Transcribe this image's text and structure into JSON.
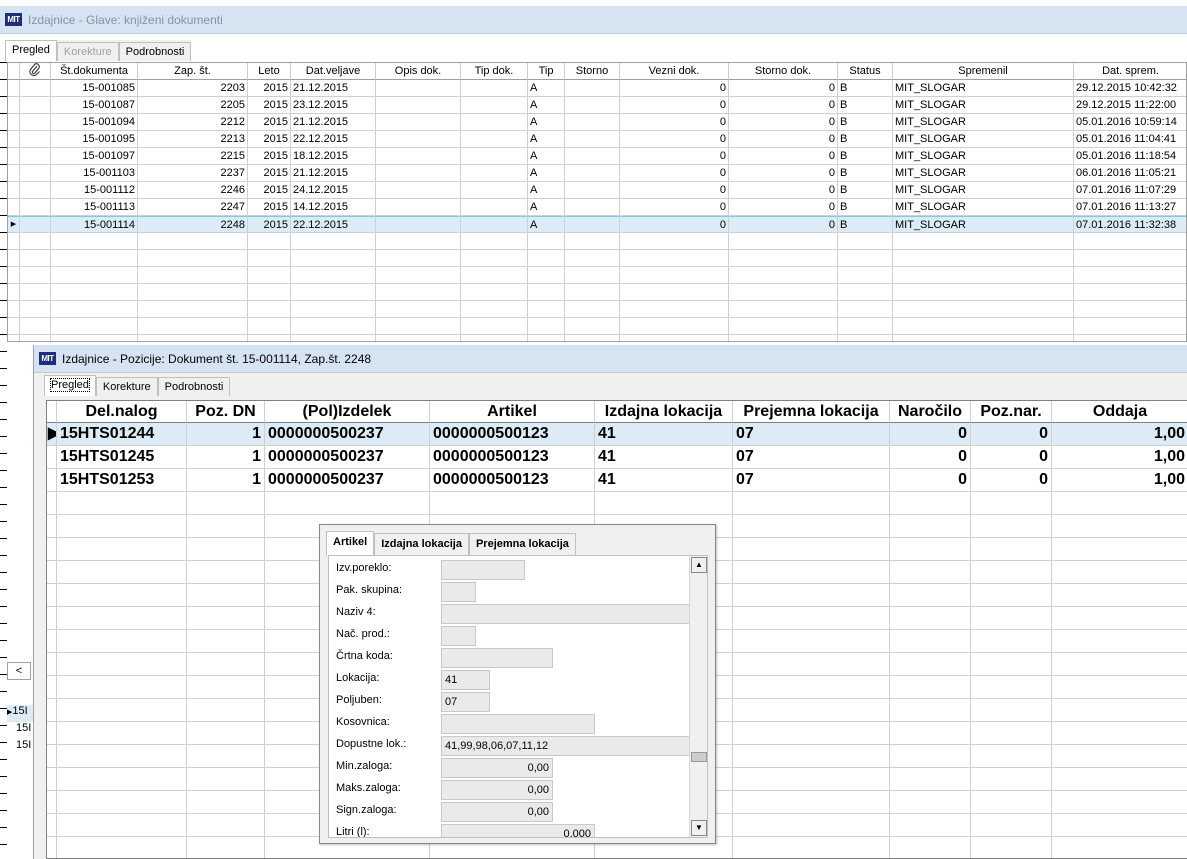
{
  "window1": {
    "title": "Izdajnice - Glave: knjiženi dokumenti",
    "tabs": [
      {
        "label": "Pregled",
        "state": "active"
      },
      {
        "label": "Korekture",
        "state": "disabled"
      },
      {
        "label": "Podrobnosti",
        "state": "normal"
      }
    ],
    "columns": [
      "Št.dokumenta",
      "Zap. št.",
      "Leto",
      "Dat.veljave",
      "Opis dok.",
      "Tip dok.",
      "Tip",
      "Storno",
      "Vezni dok.",
      "Storno dok.",
      "Status",
      "Spremenil",
      "Dat. sprem."
    ],
    "rows": [
      [
        "15-001085",
        "2203",
        "2015",
        "21.12.2015",
        "",
        "",
        "A",
        "",
        "0",
        "0",
        "B",
        "MIT_SLOGAR",
        "29.12.2015 10:42:32"
      ],
      [
        "15-001087",
        "2205",
        "2015",
        "23.12.2015",
        "",
        "",
        "A",
        "",
        "0",
        "0",
        "B",
        "MIT_SLOGAR",
        "29.12.2015 11:22:00"
      ],
      [
        "15-001094",
        "2212",
        "2015",
        "21.12.2015",
        "",
        "",
        "A",
        "",
        "0",
        "0",
        "B",
        "MIT_SLOGAR",
        "05.01.2016 10:59:14"
      ],
      [
        "15-001095",
        "2213",
        "2015",
        "22.12.2015",
        "",
        "",
        "A",
        "",
        "0",
        "0",
        "B",
        "MIT_SLOGAR",
        "05.01.2016 11:04:41"
      ],
      [
        "15-001097",
        "2215",
        "2015",
        "18.12.2015",
        "",
        "",
        "A",
        "",
        "0",
        "0",
        "B",
        "MIT_SLOGAR",
        "05.01.2016 11:18:54"
      ],
      [
        "15-001103",
        "2237",
        "2015",
        "21.12.2015",
        "",
        "",
        "A",
        "",
        "0",
        "0",
        "B",
        "MIT_SLOGAR",
        "06.01.2016 11:05:21"
      ],
      [
        "15-001112",
        "2246",
        "2015",
        "24.12.2015",
        "",
        "",
        "A",
        "",
        "0",
        "0",
        "B",
        "MIT_SLOGAR",
        "07.01.2016 11:07:29"
      ],
      [
        "15-001113",
        "2247",
        "2015",
        "14.12.2015",
        "",
        "",
        "A",
        "",
        "0",
        "0",
        "B",
        "MIT_SLOGAR",
        "07.01.2016 11:13:27"
      ],
      [
        "15-001114",
        "2248",
        "2015",
        "22.12.2015",
        "",
        "",
        "A",
        "",
        "0",
        "0",
        "B",
        "MIT_SLOGAR",
        "07.01.2016 11:32:38"
      ]
    ],
    "selected_row": 8,
    "attach_icon": "paperclip-icon",
    "scrap_rows": [
      "15I",
      "15I",
      "15I"
    ],
    "scroll_left_arrow": "<"
  },
  "window2": {
    "title": "Izdajnice - Pozicije: Dokument št. 15-001114, Zap.št. 2248",
    "tabs": [
      {
        "label": "Pregled",
        "state": "active"
      },
      {
        "label": "Korekture",
        "state": "normal"
      },
      {
        "label": "Podrobnosti",
        "state": "normal"
      }
    ],
    "columns": [
      "Del.nalog",
      "Poz. DN",
      "(Pol)Izdelek",
      "Artikel",
      "Izdajna lokacija",
      "Prejemna lokacija",
      "Naročilo",
      "Poz.nar.",
      "Oddaja"
    ],
    "rows": [
      [
        "15HTS01244",
        "1",
        "0000000500237",
        "0000000500123",
        "41",
        "07",
        "0",
        "0",
        "1,00"
      ],
      [
        "15HTS01245",
        "1",
        "0000000500237",
        "0000000500123",
        "41",
        "07",
        "0",
        "0",
        "1,00"
      ],
      [
        "15HTS01253",
        "1",
        "0000000500237",
        "0000000500123",
        "41",
        "07",
        "0",
        "0",
        "1,00"
      ]
    ],
    "selected_row": 0
  },
  "popup": {
    "tabs": [
      {
        "label": "Artikel",
        "state": "active"
      },
      {
        "label": "Izdajna lokacija",
        "state": "normal"
      },
      {
        "label": "Prejemna lokacija",
        "state": "normal"
      }
    ],
    "fields": [
      {
        "label": "Izv.poreklo:",
        "value": ""
      },
      {
        "label": "Pak. skupina:",
        "value": ""
      },
      {
        "label": "Naziv 4:",
        "value": ""
      },
      {
        "label": "Nač. prod.:",
        "value": ""
      },
      {
        "label": "Črtna koda:",
        "value": ""
      },
      {
        "label": "Lokacija:",
        "value": "41"
      },
      {
        "label": "Poljuben:",
        "value": "07"
      },
      {
        "label": "Kosovnica:",
        "value": ""
      },
      {
        "label": "Dopustne lok.:",
        "value": "41,99,98,06,07,11,12"
      },
      {
        "label": "Min.zaloga:",
        "value": "0,00"
      },
      {
        "label": "Maks.zaloga:",
        "value": "0,00"
      },
      {
        "label": "Sign.zaloga:",
        "value": "0,00"
      },
      {
        "label": "Litri (l):",
        "value": "0,000"
      }
    ]
  }
}
